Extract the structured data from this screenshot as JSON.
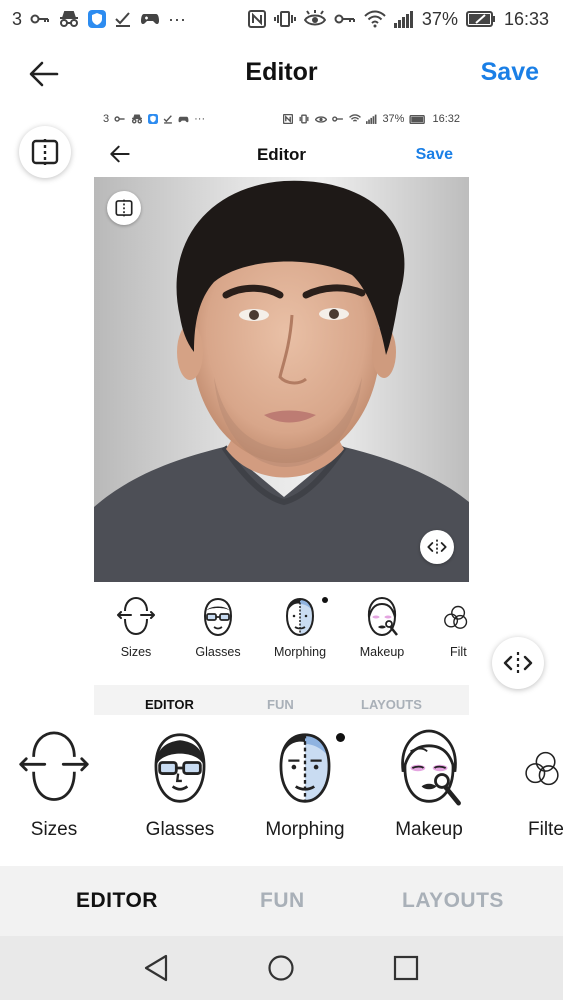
{
  "status_bar": {
    "notif_count": "3",
    "more": "···",
    "battery": "37%",
    "time": "16:33"
  },
  "header": {
    "title": "Editor",
    "save_label": "Save"
  },
  "preview": {
    "status_bar": {
      "notif_count": "3",
      "battery": "37%",
      "time": "16:32"
    },
    "title": "Editor",
    "save_label": "Save",
    "tools": [
      {
        "label": "Sizes",
        "icon": "sizes-icon"
      },
      {
        "label": "Glasses",
        "icon": "glasses-icon"
      },
      {
        "label": "Morphing",
        "icon": "morphing-icon"
      },
      {
        "label": "Makeup",
        "icon": "makeup-icon"
      },
      {
        "label": "Filt",
        "icon": "filter-icon"
      }
    ],
    "tabs": [
      "EDITOR",
      "FUN",
      "LAYOUTS"
    ]
  },
  "tools": [
    {
      "label": "Sizes",
      "icon": "sizes-icon"
    },
    {
      "label": "Glasses",
      "icon": "glasses-icon"
    },
    {
      "label": "Morphing",
      "icon": "morphing-icon"
    },
    {
      "label": "Makeup",
      "icon": "makeup-icon"
    },
    {
      "label": "Filte",
      "icon": "filter-icon"
    }
  ],
  "tabs": [
    {
      "label": "EDITOR",
      "active": true
    },
    {
      "label": "FUN",
      "active": false
    },
    {
      "label": "LAYOUTS",
      "active": false
    }
  ],
  "colors": {
    "accent": "#1a7fe6",
    "inactive_tab": "#a9b0b8",
    "tab_bar_bg": "#f2f2f2",
    "nav_bar_bg": "#e9e9e9"
  }
}
